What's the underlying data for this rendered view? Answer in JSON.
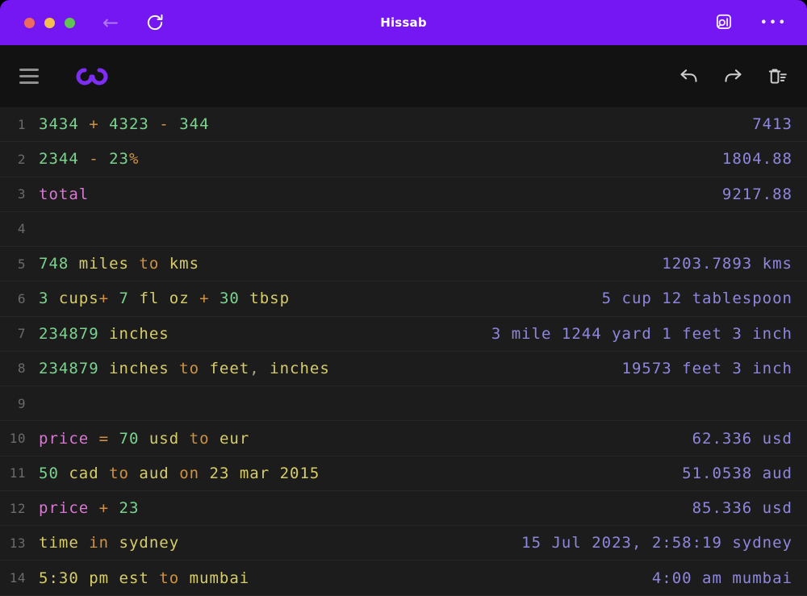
{
  "window": {
    "title": "Hissab"
  },
  "titlebar": {
    "traffic_lights": [
      "close",
      "minimize",
      "zoom"
    ],
    "back_label": "←",
    "dots_label": "•••",
    "icons": [
      "back-arrow",
      "refresh-icon",
      "search-page-icon",
      "more-ellipsis"
    ]
  },
  "toolbar": {
    "icons": [
      "menu-hamburger",
      "hissab-infinity-logo",
      "undo-icon",
      "redo-icon",
      "clear-all-trash-icon"
    ]
  },
  "colors": {
    "titlebar": "#7517f2",
    "bg-toolbar": "#121212",
    "bg-content": "#1c1c1c",
    "separator": "#272727",
    "linenum": "#6b6b6b",
    "result": "#8e87de",
    "num": "#7bd38f",
    "op": "#cf9242",
    "unit": "#d6cd6a",
    "var": "#d878d2",
    "punct": "#a8a88a",
    "tl-red": "#ed6a5e",
    "tl-yellow": "#f4bf4f",
    "tl-green": "#61c554",
    "logo": "#7e2df5"
  },
  "rows": [
    {
      "n": "1",
      "expr": [
        {
          "t": "3434 ",
          "c": "num"
        },
        {
          "t": "+ ",
          "c": "op"
        },
        {
          "t": "4323 ",
          "c": "num"
        },
        {
          "t": "- ",
          "c": "op"
        },
        {
          "t": "344",
          "c": "num"
        }
      ],
      "result": "7413"
    },
    {
      "n": "2",
      "expr": [
        {
          "t": "2344 ",
          "c": "num"
        },
        {
          "t": "- ",
          "c": "op"
        },
        {
          "t": "23",
          "c": "num"
        },
        {
          "t": "%",
          "c": "op"
        }
      ],
      "result": "1804.88"
    },
    {
      "n": "3",
      "expr": [
        {
          "t": "total",
          "c": "var"
        }
      ],
      "result": "9217.88"
    },
    {
      "n": "4",
      "expr": [],
      "result": ""
    },
    {
      "n": "5",
      "expr": [
        {
          "t": "748 ",
          "c": "num"
        },
        {
          "t": "miles ",
          "c": "unit"
        },
        {
          "t": "to ",
          "c": "op"
        },
        {
          "t": "kms",
          "c": "unit"
        }
      ],
      "result": "1203.7893 kms"
    },
    {
      "n": "6",
      "expr": [
        {
          "t": "3 ",
          "c": "num"
        },
        {
          "t": "cups",
          "c": "unit"
        },
        {
          "t": "+ ",
          "c": "op"
        },
        {
          "t": "7 ",
          "c": "num"
        },
        {
          "t": "fl oz ",
          "c": "unit"
        },
        {
          "t": "+ ",
          "c": "op"
        },
        {
          "t": "30 ",
          "c": "num"
        },
        {
          "t": "tbsp",
          "c": "unit"
        }
      ],
      "result": "5 cup 12 tablespoon"
    },
    {
      "n": "7",
      "expr": [
        {
          "t": "234879 ",
          "c": "num"
        },
        {
          "t": "inches",
          "c": "unit"
        }
      ],
      "result": "3 mile 1244 yard 1 feet 3 inch"
    },
    {
      "n": "8",
      "expr": [
        {
          "t": "234879 ",
          "c": "num"
        },
        {
          "t": "inches ",
          "c": "unit"
        },
        {
          "t": "to ",
          "c": "op"
        },
        {
          "t": "feet",
          "c": "unit"
        },
        {
          "t": ", ",
          "c": "punct"
        },
        {
          "t": "inches",
          "c": "unit"
        }
      ],
      "result": "19573 feet 3 inch"
    },
    {
      "n": "9",
      "expr": [],
      "result": ""
    },
    {
      "n": "10",
      "expr": [
        {
          "t": "price ",
          "c": "var"
        },
        {
          "t": "= ",
          "c": "op"
        },
        {
          "t": "70 ",
          "c": "num"
        },
        {
          "t": "usd ",
          "c": "unit"
        },
        {
          "t": "to ",
          "c": "op"
        },
        {
          "t": "eur",
          "c": "unit"
        }
      ],
      "result": "62.336 usd"
    },
    {
      "n": "11",
      "expr": [
        {
          "t": "50 ",
          "c": "num"
        },
        {
          "t": "cad ",
          "c": "unit"
        },
        {
          "t": "to ",
          "c": "op"
        },
        {
          "t": "aud ",
          "c": "unit"
        },
        {
          "t": "on ",
          "c": "op"
        },
        {
          "t": "23 mar 2015",
          "c": "unit"
        }
      ],
      "result": "51.0538 aud"
    },
    {
      "n": "12",
      "expr": [
        {
          "t": "price ",
          "c": "var"
        },
        {
          "t": "+ ",
          "c": "op"
        },
        {
          "t": "23",
          "c": "num"
        }
      ],
      "result": "85.336 usd"
    },
    {
      "n": "13",
      "expr": [
        {
          "t": "time ",
          "c": "unit"
        },
        {
          "t": "in ",
          "c": "op"
        },
        {
          "t": "sydney",
          "c": "unit"
        }
      ],
      "result": "15 Jul 2023, 2:58:19 sydney"
    },
    {
      "n": "14",
      "expr": [
        {
          "t": "5:30 pm est ",
          "c": "unit"
        },
        {
          "t": "to ",
          "c": "op"
        },
        {
          "t": "mumbai",
          "c": "unit"
        }
      ],
      "result": "4:00 am mumbai"
    }
  ]
}
